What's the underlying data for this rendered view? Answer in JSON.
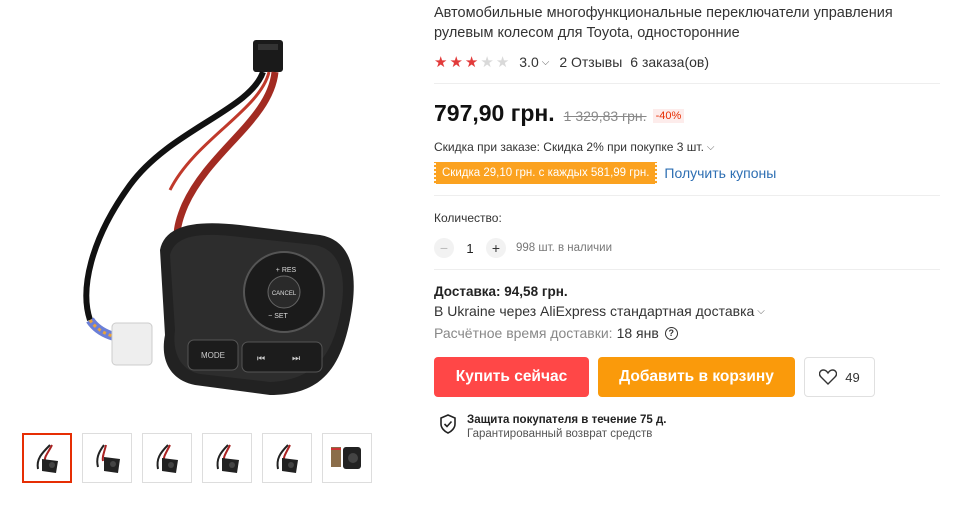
{
  "gallery": {
    "main_image_icon": "steering-wheel-control-switch-image",
    "main_image_labels": {
      "plus_res": "+ RES",
      "cancel": "CANCEL",
      "minus_set": "− SET",
      "mode": "MODE"
    },
    "thumbnail_count": 6
  },
  "product": {
    "title": "Автомобильные многофункциональные переключатели управления рулевым колесом для Toyota, односторонние",
    "rating": {
      "stars_filled": 3,
      "stars_total": 5,
      "value": "3.0",
      "reviews": "2 Отзывы",
      "orders": "6 заказа(ов)"
    },
    "price": "797,90 грн.",
    "old_price": "1 329,83 грн.",
    "discount": "-40%",
    "sale_text": "Скидка при заказе: Скидка 2% при покупке 3 шт.",
    "coupon_text": "Скидка 29,10 грн. с каждых 581,99 грн.",
    "get_coupons": "Получить купоны",
    "quantity_label": "Количество:",
    "quantity_value": "1",
    "stock": "998 шт. в наличии",
    "shipping_cost": "Доставка: 94,58 грн.",
    "shipping_method": "В Ukraine через AliExpress стандартная доставка",
    "delivery_label": "Расчётное время доставки:",
    "delivery_date": "18 янв",
    "buy_now": "Купить сейчас",
    "add_to_cart": "Добавить в корзину",
    "wishlist_count": "49",
    "protection_title": "Защита покупателя в течение 75 д.",
    "protection_sub": "Гарантированный возврат средств"
  },
  "colors": {
    "buy_button": "#ff4747",
    "cart_button": "#fa9a0b",
    "coupon_bg": "#fba220",
    "star_on": "#e23b3b",
    "link": "#2e6fb3",
    "active_thumb": "#e62e04"
  }
}
